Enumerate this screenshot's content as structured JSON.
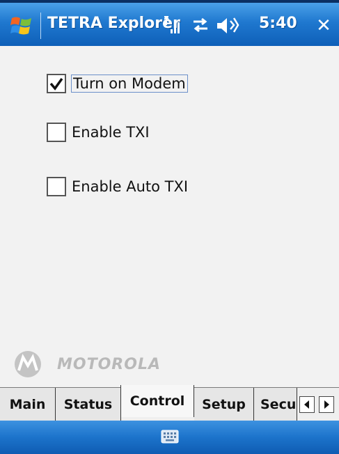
{
  "title_bar": {
    "app_title": "TETRA Explorer",
    "time": "5:40",
    "icons": [
      "windows-flag-icon",
      "signal-strength-icon",
      "connectivity-icon",
      "speaker-icon",
      "close-icon"
    ]
  },
  "controls": {
    "checkboxes": [
      {
        "label": "Turn on Modem",
        "checked": true,
        "focused": true
      },
      {
        "label": "Enable TXI",
        "checked": false,
        "focused": false
      },
      {
        "label": "Enable Auto TXI",
        "checked": false,
        "focused": false
      }
    ]
  },
  "branding": {
    "logo_text": "MOTOROLA"
  },
  "tabs": {
    "items": [
      {
        "label": "Main"
      },
      {
        "label": "Status"
      },
      {
        "label": "Control"
      },
      {
        "label": "Setup"
      },
      {
        "label": "Secu"
      }
    ],
    "selected": "Control"
  },
  "menu_bar": {
    "icons": [
      "keyboard-icon"
    ]
  },
  "colors": {
    "title_bar": "#1f78cf",
    "background": "#f2f2f2",
    "focus_outline": "#6b8fc9"
  }
}
